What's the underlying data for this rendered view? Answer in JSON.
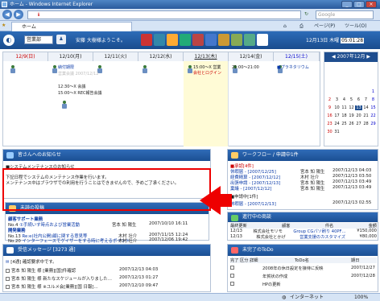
{
  "window": {
    "title": "ホーム - Windows Internet Explorer"
  },
  "address": {
    "search_placeholder": "Google"
  },
  "tab": {
    "label": "ホーム"
  },
  "cmdbar": {
    "page": "ページ(P)",
    "tools": "ツール(O)"
  },
  "app": {
    "group": "営業部",
    "welcome": "安藤 大樹様ようこそ。",
    "date": "12月13日 木曜",
    "time": "05:01:28"
  },
  "calendar": {
    "days": [
      "12/9(日)",
      "12/10(月)",
      "12/11(火)",
      "12/12(水)",
      "12/13(木)",
      "12/14(金)",
      "12/15(土)"
    ],
    "events": [
      {
        "text": "納付期限",
        "col": 1
      },
      {
        "text": "営業会議 2007/12/12",
        "col": 1
      },
      {
        "text": "12:30～X 会議",
        "col": 1
      },
      {
        "text": "15:00～X REC報告会議",
        "col": 1
      },
      {
        "text": "15:00～X 営業",
        "col": 4
      },
      {
        "text": "会社とログイン",
        "col": 4
      },
      {
        "text": "21:00～21:00",
        "col": 5
      },
      {
        "text": "■プラネタリウム",
        "col": 6
      }
    ]
  },
  "minical": {
    "title": "2007年12月",
    "days": [
      "",
      "",
      "",
      "",
      "",
      "",
      "1",
      "2",
      "3",
      "4",
      "5",
      "6",
      "7",
      "8",
      "9",
      "10",
      "11",
      "12",
      "13",
      "14",
      "15",
      "16",
      "17",
      "18",
      "19",
      "20",
      "21",
      "22",
      "23",
      "24",
      "25",
      "26",
      "27",
      "28",
      "29",
      "30",
      "31"
    ]
  },
  "notice": {
    "title": "皆さんへのお知らせ",
    "heading": "■システムメンテナンスのお知らせ",
    "body1": "下記日程でシステムのメンテナンス作業を行います。",
    "body2": "メンテナンス中はブラウザでの利用を行うことはできませんので、予めご了承ください。"
  },
  "unread": {
    "title": "未読の投稿",
    "cat1": "顧客サポート業務",
    "row1": {
      "no": "No.4",
      "subj": "①手続いす時点および営業活動",
      "author": "宮本 知 陽生",
      "date": "2007/10/10 16:11"
    },
    "cat2": "開発業務",
    "row2": {
      "no": "No.13",
      "subj": "Re:e(社内公開)顧に関する意見等",
      "author": "木村 壮介",
      "date": "2007/11/15 12:24"
    },
    "row3": {
      "no": "No.20",
      "subj": "インターフェースでゲイザーをする時に考えるポイント",
      "author": "木村 壮介",
      "date": "2007/12/06 19:42"
    }
  },
  "inbox": {
    "title": "受信メッセージ [3273 通]",
    "line": "[4通] 確認要求中です。",
    "rows": [
      {
        "subj": "宮本 知 陽生 様 [業務][国]",
        "sub2": "件確認",
        "date": "2007/12/13 04:03"
      },
      {
        "subj": "宮本 知 陽生 様 新たなスケジュールが入りました…",
        "sub2": "",
        "date": "2007/12/13 01:27"
      },
      {
        "subj": "宮本 知 陽生 様 ※ユルメ会[業務][国 日報]…",
        "sub2": "",
        "date": "2007/12/10 09:47"
      }
    ]
  },
  "workflow": {
    "title": "ワークフロー / 申請中1件",
    "section": "■承認[4件]",
    "rows": [
      {
        "name": "休暇届 - [2007/12/25]",
        "person": "宮本 知 陽生",
        "date": "2007/12/13 04:03"
      },
      {
        "name": "経費精算 - [2007/12/12]",
        "person": "木村 壮介",
        "date": "2007/12/13 03:50"
      },
      {
        "name": "出張申請 - [2007/12/13]",
        "person": "宮本 知 陽生",
        "date": "2007/12/13 03:49"
      },
      {
        "name": "稟議 - [2007/12/12]",
        "person": "宮本 知 陽生",
        "date": "2007/12/13 03:49"
      }
    ],
    "section2": "■申請中[1件]",
    "row2": {
      "name": "休暇届 - [2007/12/13]",
      "date": "2007/12/13 02:55"
    }
  },
  "deals": {
    "title": "進行中の商談",
    "headers": [
      "最終更新",
      "顧客",
      "件名",
      "金額"
    ],
    "rows": [
      {
        "date": "12/13",
        "cust": "株式会社モリモ",
        "subj": "Group CGパソ刷り 40PF…",
        "amt": "¥150,000"
      },
      {
        "date": "12/13",
        "cust": "株式会社とかげ",
        "subj": "営業支援のカスタマイズ",
        "amt": "¥80,000"
      }
    ]
  },
  "todo": {
    "title": "未完了のToDo",
    "headers": [
      "完了",
      "区分",
      "詳細",
      "ToDo名",
      "期日"
    ],
    "rows": [
      {
        "name": "2008年の休日設定を接待に反映",
        "due": "2007/12/27"
      },
      {
        "name": "年賀状の作成",
        "due": "2007/12/28"
      },
      {
        "name": "HPの更新",
        "due": ""
      }
    ]
  },
  "status": {
    "zone": "インターネット",
    "zoom": "100%"
  },
  "colors": {
    "header": "#1f4e8f",
    "highlight": "#e00000"
  }
}
